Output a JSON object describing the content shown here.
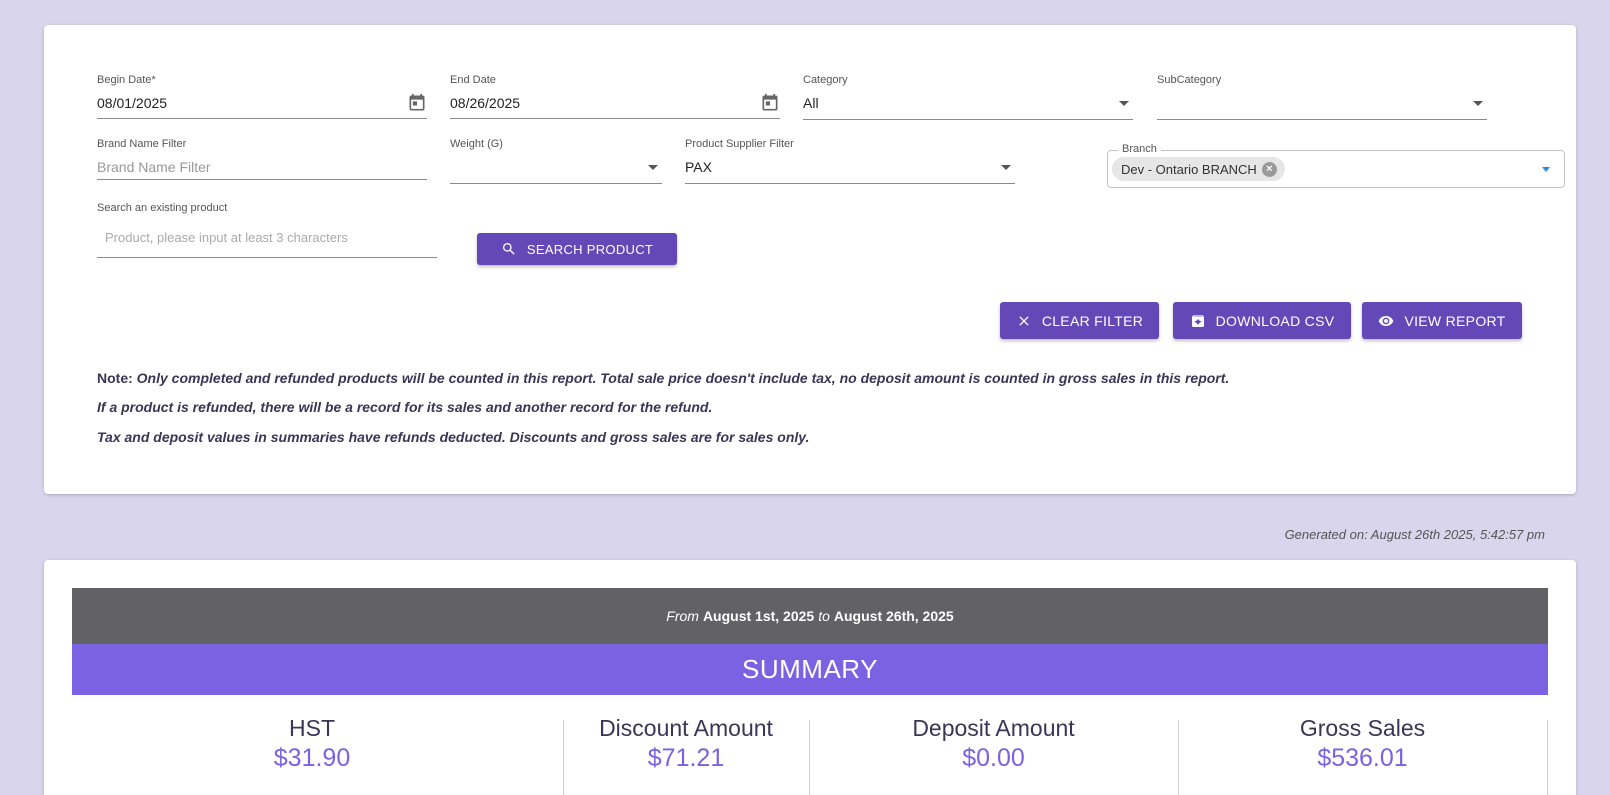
{
  "filters": {
    "begin_date": {
      "label": "Begin Date*",
      "value": "08/01/2025"
    },
    "end_date": {
      "label": "End Date",
      "value": "08/26/2025"
    },
    "category": {
      "label": "Category",
      "value": "All"
    },
    "subcategory": {
      "label": "SubCategory",
      "value": ""
    },
    "brand": {
      "label": "Brand Name Filter",
      "placeholder": "Brand Name Filter"
    },
    "weight": {
      "label": "Weight (G)",
      "value": ""
    },
    "supplier": {
      "label": "Product Supplier Filter",
      "value": "PAX"
    },
    "branch": {
      "label": "Branch",
      "chip": "Dev - Ontario BRANCH"
    },
    "product_search": {
      "label": "Search an existing product",
      "placeholder": "Product, please input at least 3 characters"
    }
  },
  "buttons": {
    "search_product": "SEARCH PRODUCT",
    "clear_filter": "CLEAR FILTER",
    "download_csv": "DOWNLOAD CSV",
    "view_report": "VIEW REPORT"
  },
  "notes": {
    "prefix": "Note:",
    "line1": " Only completed and refunded products will be counted in this report. Total sale price doesn't include tax, no deposit amount is counted in gross sales in this report.",
    "line2": "If a product is refunded, there will be a record for its sales and another record for the refund.",
    "line3": "Tax and deposit values in summaries have refunds deducted. Discounts and gross sales are for sales only."
  },
  "generated": "Generated on: August 26th 2025, 5:42:57 pm",
  "report": {
    "from_label": "From",
    "from_date": "August 1st, 2025",
    "to_label": "to",
    "to_date": "August 26th, 2025",
    "summary_title": "SUMMARY",
    "stats": [
      {
        "title": "HST",
        "value": "$31.90"
      },
      {
        "title": "Discount Amount",
        "value": "$71.21"
      },
      {
        "title": "Deposit Amount",
        "value": "$0.00"
      },
      {
        "title": "Gross Sales",
        "value": "$536.01"
      }
    ]
  },
  "colors": {
    "background": "#d9d5ec",
    "primary_button": "#6448b8",
    "summary_bar": "#7a62e3",
    "range_bar": "#626166",
    "stat_value": "#7a62e3"
  }
}
